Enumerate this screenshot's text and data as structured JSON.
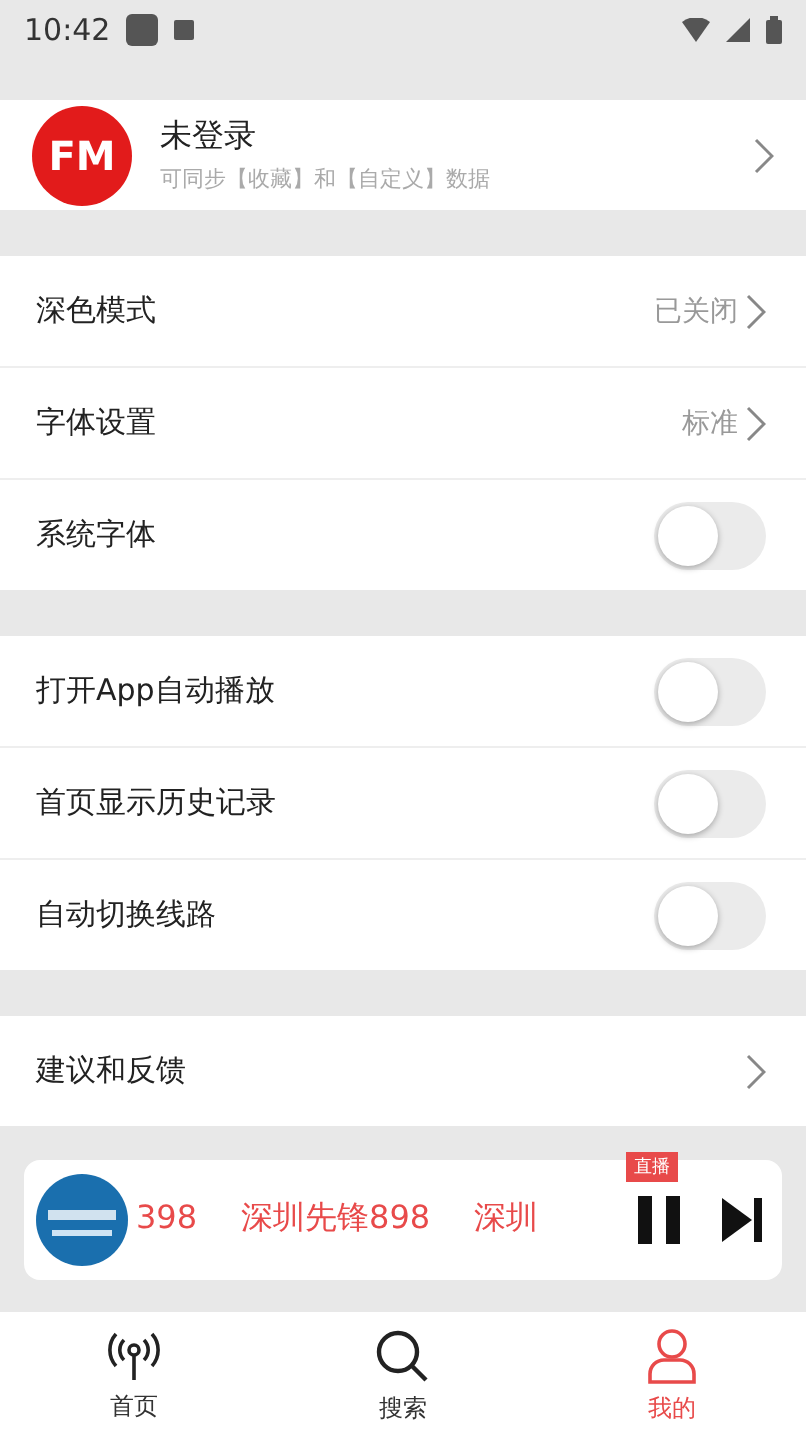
{
  "status_bar": {
    "time": "10:42"
  },
  "profile": {
    "logo": "FM",
    "name": "未登录",
    "subtitle": "可同步【收藏】和【自定义】数据"
  },
  "sections": [
    {
      "rows": [
        {
          "kind": "value",
          "label": "深色模式",
          "value": "已关闭"
        },
        {
          "kind": "value",
          "label": "字体设置",
          "value": "标准"
        },
        {
          "kind": "toggle",
          "label": "系统字体",
          "on": false
        }
      ]
    },
    {
      "rows": [
        {
          "kind": "toggle",
          "label": "打开App自动播放",
          "on": false
        },
        {
          "kind": "toggle",
          "label": "首页显示历史记录",
          "on": false
        },
        {
          "kind": "toggle",
          "label": "自动切换线路",
          "on": false
        }
      ]
    },
    {
      "rows": [
        {
          "kind": "link",
          "label": "建议和反馈"
        }
      ]
    }
  ],
  "player": {
    "marquee": [
      "398",
      "深圳先锋898",
      "深圳"
    ],
    "badge": "直播",
    "playing": true
  },
  "tabs": [
    {
      "label": "首页",
      "kind": "radio",
      "selected": false
    },
    {
      "label": "搜索",
      "kind": "search",
      "selected": false
    },
    {
      "label": "我的",
      "kind": "person",
      "selected": true
    }
  ]
}
